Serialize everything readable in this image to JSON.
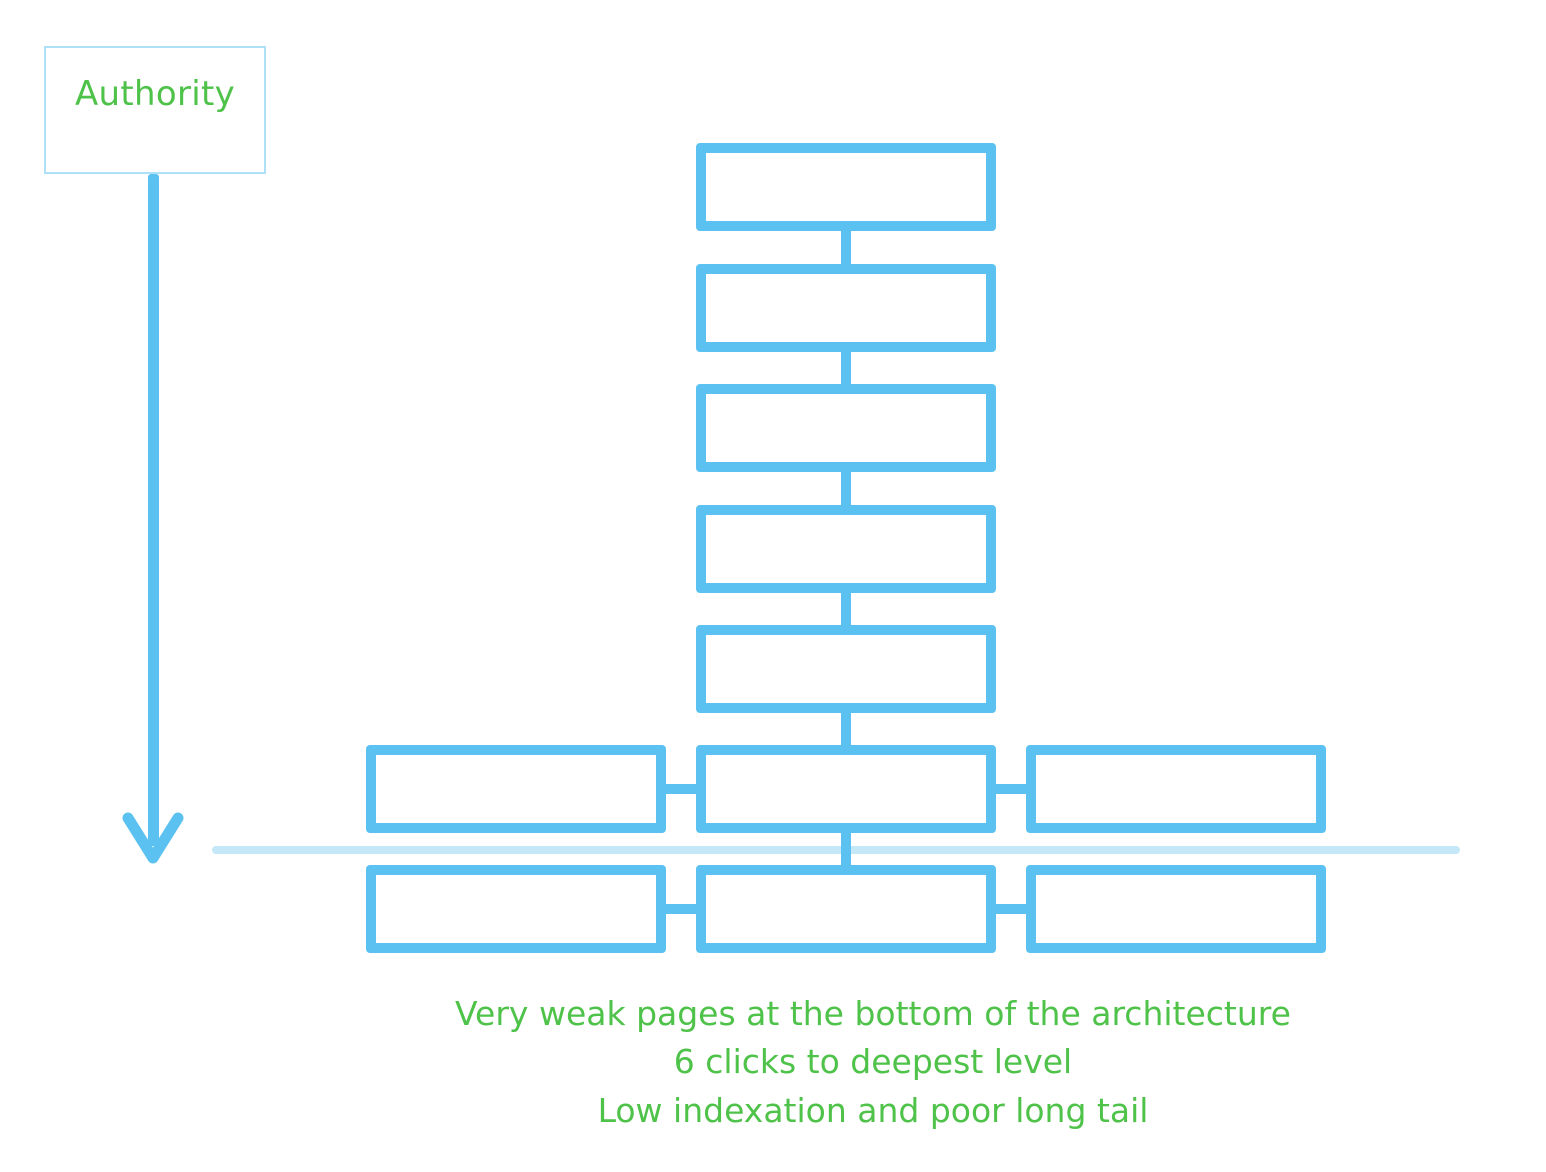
{
  "authority": {
    "label": "Authority",
    "arrow_icon": "arrow-down-icon"
  },
  "diagram": {
    "description": "Deep site architecture: single column of pages, branching at the bottom levels",
    "levels": [
      {
        "level": 1,
        "nodes": 1
      },
      {
        "level": 2,
        "nodes": 1
      },
      {
        "level": 3,
        "nodes": 1
      },
      {
        "level": 4,
        "nodes": 1
      },
      {
        "level": 5,
        "nodes": 1
      },
      {
        "level": 6,
        "nodes": 3
      },
      {
        "level": 7,
        "nodes": 3
      }
    ]
  },
  "captions": [
    "Very weak pages at the bottom of the architecture",
    "6 clicks to deepest level",
    "Low indexation and poor long tail"
  ],
  "colors": {
    "node_border": "#5bc1f0",
    "text": "#4fc24a",
    "cutoff_line": "#c4e8f8"
  }
}
